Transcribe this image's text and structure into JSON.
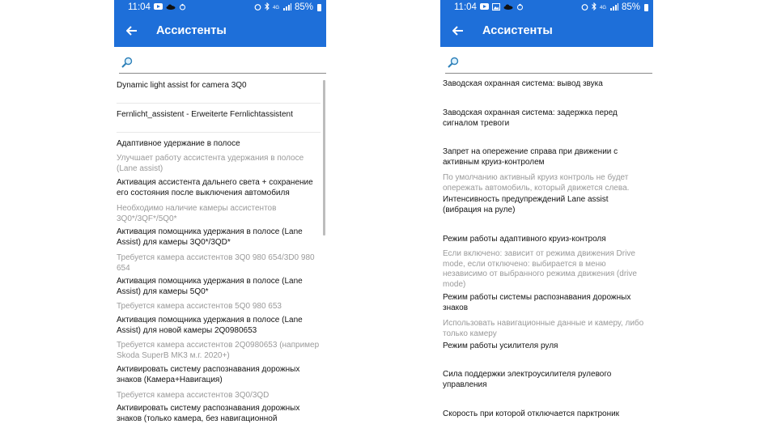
{
  "statusbar": {
    "left": {
      "time": "11:04",
      "icons": [
        "youtube-icon",
        "cloud-icon",
        "bug-icon"
      ]
    },
    "right": {
      "time": "11:04",
      "icons": [
        "youtube-icon",
        "image-icon",
        "cloud-icon",
        "bug-icon"
      ]
    },
    "battery": "85%"
  },
  "appbar": {
    "title": "Ассистенты"
  },
  "search": {
    "placeholder": ""
  },
  "left_list": [
    {
      "title": "Dynamic light assist for camera 3Q0",
      "desc": ""
    },
    {
      "title": "Fernlicht_assistent - Erweiterte Fernlichtassistent",
      "desc": ""
    },
    {
      "title": "Адаптивное удержание в полосе",
      "desc": "Улучшает работу ассистента удержания в полосе (Lane assist)"
    },
    {
      "title": "Активация ассистента дальнего света + сохранение его состояния после выключения автомобиля",
      "desc": "Необходимо наличие камеры ассистентов 3Q0*/3QF*/5Q0*"
    },
    {
      "title": "Активация помощника удержания в полосе (Lane Assist) для камеры 3Q0*/3QD*",
      "desc": "Требуется камера ассистентов 3Q0 980 654/3D0 980 654"
    },
    {
      "title": "Активация помощника удержания в полосе (Lane Assist) для камеры 5Q0*",
      "desc": "Требуется камера ассистентов 5Q0 980 653"
    },
    {
      "title": "Активация помощника удержания в полосе (Lane Assist) для новой камеры 2Q0980653",
      "desc": "Требуется камера ассистентов 2Q0980653 (например Skoda SuperB MK3 м.г. 2020+)"
    },
    {
      "title": "Активировать систему распознавания дорожных знаков (Камера+Навигация)",
      "desc": "Требуется камера ассистентов 3Q0/3QD"
    },
    {
      "title": "Активировать систему распознавания дорожных знаков (только камера, без навигационной",
      "desc": ""
    }
  ],
  "right_list": [
    {
      "title": "Заводская охранная система: вывод звука",
      "desc": ""
    },
    {
      "title": "Заводская охранная система: задержка перед сигналом тревоги",
      "desc": ""
    },
    {
      "title": "Запрет на опережение справа при движении с активным круиз-контролем",
      "desc": "По умолчанию активный круиз контроль не будет опережать автомобиль, который движется слева."
    },
    {
      "title": "Интенсивность предупреждений Lane assist (вибрация на руле)",
      "desc": ""
    },
    {
      "title": "Режим работы адаптивного круиз-контроля",
      "desc": "Если включено: зависит от режима движения Drive mode, если отключено: выбирается в меню независимо от выбранного режима движения (drive mode)"
    },
    {
      "title": "Режим работы системы распознавания дорожных знаков",
      "desc": "Использовать навигационные данные и камеру, либо только камеру"
    },
    {
      "title": "Режим работы усилителя руля",
      "desc": ""
    },
    {
      "title": "Сила поддержки электроусилителя рулевого управления",
      "desc": ""
    },
    {
      "title": "Скорость при которой отключается парктроник",
      "desc": ""
    }
  ]
}
